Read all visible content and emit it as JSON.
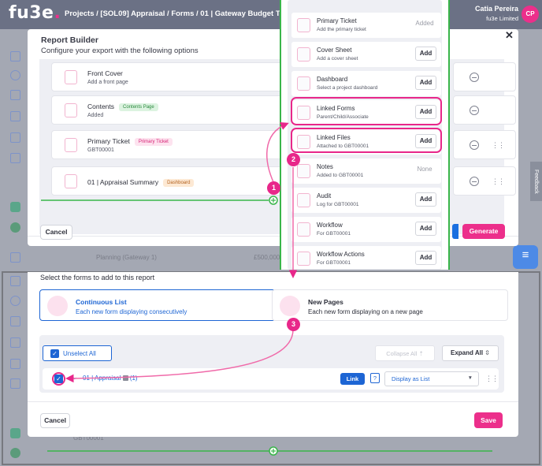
{
  "app": {
    "logo_main": "fu3e",
    "logo_dot": ".",
    "breadcrumb": "Projects / [SOL09] Appraisal / Forms / 01 | Gateway Budget Tracker /",
    "user_name": "Catia Pereira",
    "user_org": "fu3e Limited",
    "user_initials": "CP",
    "feedback_label": "Feedback"
  },
  "background": {
    "planning_label": "Planning (Gateway 1)",
    "planning_amount": "£500,000",
    "gbt_ref": "GBT00001"
  },
  "report_builder": {
    "title": "Report Builder",
    "subtitle": "Configure your export with the following options",
    "close_symbol": "✕",
    "items": [
      {
        "name": "Front Cover",
        "sub": "Add a front page",
        "tag": ""
      },
      {
        "name": "Contents",
        "sub": "Added",
        "tag": "Contents Page"
      },
      {
        "name": "Primary Ticket",
        "sub": "GBT00001",
        "tag": "Primary Ticket"
      },
      {
        "name": "01 | Appraisal Summary",
        "sub": "",
        "tag": "Dashboard"
      }
    ],
    "cancel_label": "Cancel",
    "generate_label": "Generate"
  },
  "add_panel": {
    "items": [
      {
        "name": "Primary Ticket",
        "sub": "Add the primary ticket",
        "action": "Added"
      },
      {
        "name": "Cover Sheet",
        "sub": "Add a cover sheet",
        "action": "Add"
      },
      {
        "name": "Dashboard",
        "sub": "Select a project dashboard",
        "action": "Add"
      },
      {
        "name": "Linked Forms",
        "sub": "Parent/Child/Associate",
        "action": "Add"
      },
      {
        "name": "Linked Files",
        "sub": "Attached to GBT00001",
        "action": "Add"
      },
      {
        "name": "Notes",
        "sub": "Added to GBT00001",
        "action": "None"
      },
      {
        "name": "Audit",
        "sub": "Log for GBT00001",
        "action": "Add"
      },
      {
        "name": "Workflow",
        "sub": "For GBT00001",
        "action": "Add"
      },
      {
        "name": "Workflow Actions",
        "sub": "For GBT00001",
        "action": "Add"
      }
    ]
  },
  "select_forms": {
    "title": "Select the forms to add to this report",
    "options": [
      {
        "name": "Continuous List",
        "sub": "Each new form displaying consecutively"
      },
      {
        "name": "New Pages",
        "sub": "Each new form displaying on a new page"
      }
    ],
    "unselect_all_label": "Unselect All",
    "collapse_all_label": "Collapse All",
    "expand_all_label": "Expand All",
    "form_name": "01 | Appraisal",
    "form_count": "(1)",
    "link_label": "Link",
    "help_symbol": "?",
    "display_value": "Display as List",
    "cancel_label": "Cancel",
    "save_label": "Save"
  },
  "annotations": [
    "1",
    "2",
    "3"
  ],
  "colors": {
    "brand_pink": "#ec2f8b",
    "highlight": "#e8278a",
    "primary_blue": "#1d65d4",
    "topbar": "#6b7185",
    "guide_green": "#39b54a"
  }
}
